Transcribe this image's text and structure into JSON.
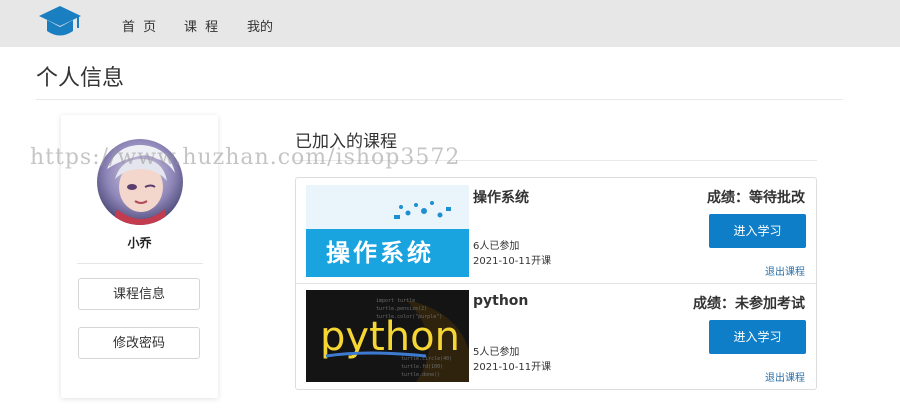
{
  "nav": {
    "items": [
      "首 页",
      "课 程",
      "我的"
    ],
    "logo_icon": "graduation-cap-icon",
    "accent": "#1a7fc1"
  },
  "page": {
    "title": "个人信息"
  },
  "profile": {
    "username": "小乔",
    "buttons": [
      "课程信息",
      "修改密码"
    ]
  },
  "courses": {
    "heading": "已加入的课程",
    "items": [
      {
        "name": "操作系统",
        "thumb_text": "操作系统",
        "members": "6人已参加",
        "start": "2021-10-11开课",
        "score": "成绩：等待批改",
        "enter_label": "进入学习",
        "exit_label": "退出课程"
      },
      {
        "name": "python",
        "thumb_text": "python",
        "members": "5人已参加",
        "start": "2021-10-11开课",
        "score": "成绩：未参加考试",
        "enter_label": "进入学习",
        "exit_label": "退出课程"
      }
    ],
    "button_color": "#0e7ec8"
  },
  "watermark": "https://www.huzhan.com/ishop3572"
}
